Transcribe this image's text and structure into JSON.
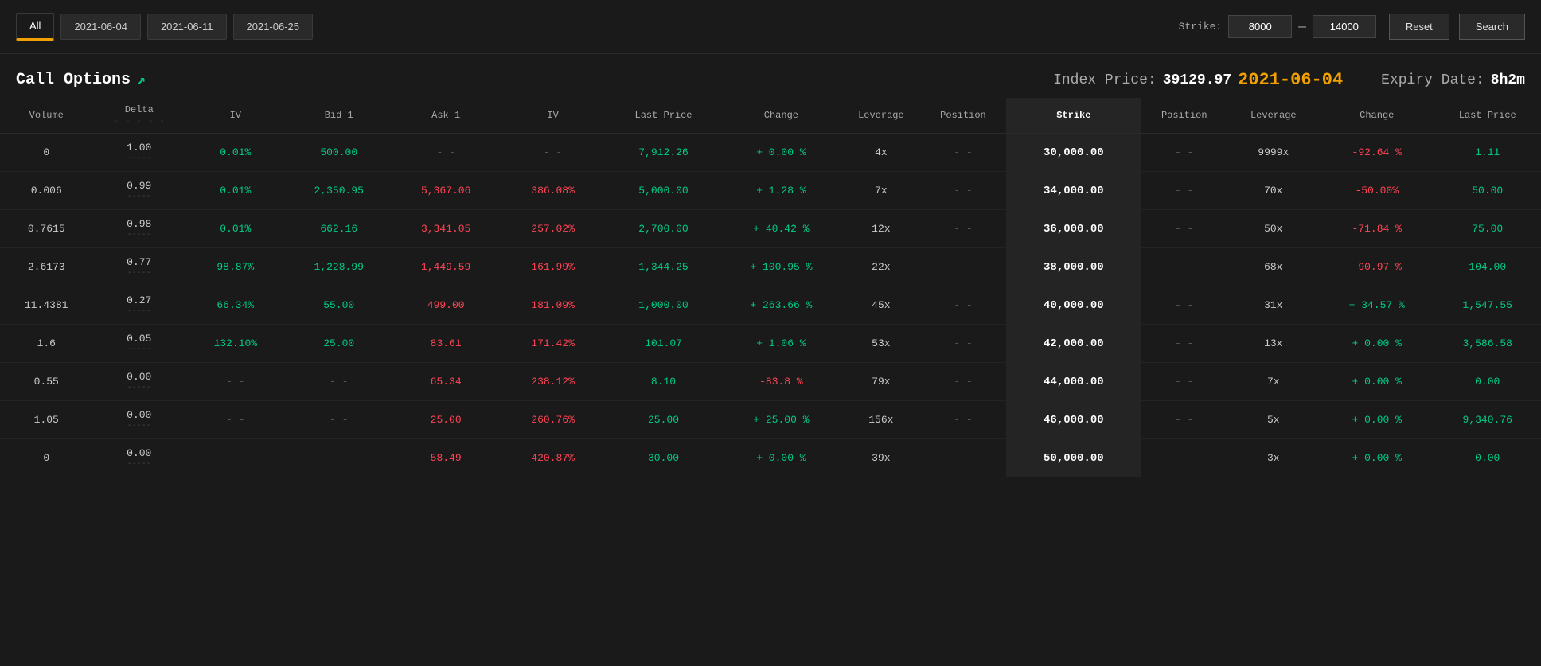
{
  "topbar": {
    "tabs": [
      {
        "label": "All",
        "active": true
      },
      {
        "label": "2021-06-04",
        "active": false
      },
      {
        "label": "2021-06-11",
        "active": false
      },
      {
        "label": "2021-06-25",
        "active": false
      }
    ],
    "strike_label": "Strike:",
    "strike_min": "8000",
    "strike_max": "14000",
    "reset_label": "Reset",
    "search_label": "Search"
  },
  "header": {
    "title": "Call Options",
    "arrow": "↗",
    "index_price_label": "Index Price:",
    "index_price_value": "39129.97",
    "expiry_date_value": "2021-06-04",
    "expiry_label": "Expiry Date:",
    "expiry_time": "8h2m"
  },
  "columns": {
    "left": [
      "Volume",
      "Delta",
      "IV",
      "Bid 1",
      "Ask 1",
      "IV",
      "Last Price",
      "Change",
      "Leverage",
      "Position"
    ],
    "center": "Strike",
    "right": [
      "Position",
      "Leverage",
      "Change",
      "Last Price"
    ]
  },
  "rows": [
    {
      "volume": "0",
      "delta": "1.00",
      "delta_sub": "-----",
      "iv1": "0.01%",
      "bid1": "500.00",
      "ask1": "- -",
      "iv2": "- -",
      "lastprice1": "7,912.26",
      "change1": "+ 0.00 %",
      "leverage1": "4x",
      "position1": "- -",
      "strike": "30,000.00",
      "position2": "- -",
      "leverage2": "9999x",
      "change2": "-92.64 %",
      "lastprice2": "1.11"
    },
    {
      "volume": "0.006",
      "delta": "0.99",
      "delta_sub": "-----",
      "iv1": "0.01%",
      "bid1": "2,350.95",
      "ask1": "5,367.06",
      "iv2": "386.08%",
      "lastprice1": "5,000.00",
      "change1": "+ 1.28 %",
      "leverage1": "7x",
      "position1": "- -",
      "strike": "34,000.00",
      "position2": "- -",
      "leverage2": "70x",
      "change2": "-50.00%",
      "lastprice2": "50.00"
    },
    {
      "volume": "0.7615",
      "delta": "0.98",
      "delta_sub": "-----",
      "iv1": "0.01%",
      "bid1": "662.16",
      "ask1": "3,341.05",
      "iv2": "257.02%",
      "lastprice1": "2,700.00",
      "change1": "+ 40.42 %",
      "leverage1": "12x",
      "position1": "- -",
      "strike": "36,000.00",
      "position2": "- -",
      "leverage2": "50x",
      "change2": "-71.84 %",
      "lastprice2": "75.00"
    },
    {
      "volume": "2.6173",
      "delta": "0.77",
      "delta_sub": "-----",
      "iv1": "98.87%",
      "bid1": "1,228.99",
      "ask1": "1,449.59",
      "iv2": "161.99%",
      "lastprice1": "1,344.25",
      "change1": "+ 100.95 %",
      "leverage1": "22x",
      "position1": "- -",
      "strike": "38,000.00",
      "position2": "- -",
      "leverage2": "68x",
      "change2": "-90.97 %",
      "lastprice2": "104.00"
    },
    {
      "volume": "11.4381",
      "delta": "0.27",
      "delta_sub": "-----",
      "iv1": "66.34%",
      "bid1": "55.00",
      "ask1": "499.00",
      "iv2": "181.09%",
      "lastprice1": "1,000.00",
      "change1": "+ 263.66 %",
      "leverage1": "45x",
      "position1": "- -",
      "strike": "40,000.00",
      "position2": "- -",
      "leverage2": "31x",
      "change2": "+ 34.57 %",
      "lastprice2": "1,547.55"
    },
    {
      "volume": "1.6",
      "delta": "0.05",
      "delta_sub": "-----",
      "iv1": "132.10%",
      "bid1": "25.00",
      "ask1": "83.61",
      "iv2": "171.42%",
      "lastprice1": "101.07",
      "change1": "+ 1.06 %",
      "leverage1": "53x",
      "position1": "- -",
      "strike": "42,000.00",
      "position2": "- -",
      "leverage2": "13x",
      "change2": "+ 0.00 %",
      "lastprice2": "3,586.58"
    },
    {
      "volume": "0.55",
      "delta": "0.00",
      "delta_sub": "-----",
      "iv1": "- -",
      "bid1": "- -",
      "ask1": "65.34",
      "iv2": "238.12%",
      "lastprice1": "8.10",
      "change1": "-83.8 %",
      "leverage1": "79x",
      "position1": "- -",
      "strike": "44,000.00",
      "position2": "- -",
      "leverage2": "7x",
      "change2": "+ 0.00 %",
      "lastprice2": "0.00"
    },
    {
      "volume": "1.05",
      "delta": "0.00",
      "delta_sub": "-----",
      "iv1": "- -",
      "bid1": "- -",
      "ask1": "25.00",
      "iv2": "260.76%",
      "lastprice1": "25.00",
      "change1": "+ 25.00 %",
      "leverage1": "156x",
      "position1": "- -",
      "strike": "46,000.00",
      "position2": "- -",
      "leverage2": "5x",
      "change2": "+ 0.00 %",
      "lastprice2": "9,340.76"
    },
    {
      "volume": "0",
      "delta": "0.00",
      "delta_sub": "-----",
      "iv1": "- -",
      "bid1": "- -",
      "ask1": "58.49",
      "iv2": "420.87%",
      "lastprice1": "30.00",
      "change1": "+ 0.00 %",
      "leverage1": "39x",
      "position1": "- -",
      "strike": "50,000.00",
      "position2": "- -",
      "leverage2": "3x",
      "change2": "+ 0.00 %",
      "lastprice2": "0.00"
    }
  ],
  "colors": {
    "green": "#00cc88",
    "red": "#ff4455",
    "yellow": "#f0a000",
    "dim": "#555555",
    "bg_dark": "#1a1a1a",
    "bg_mid": "#242424"
  }
}
